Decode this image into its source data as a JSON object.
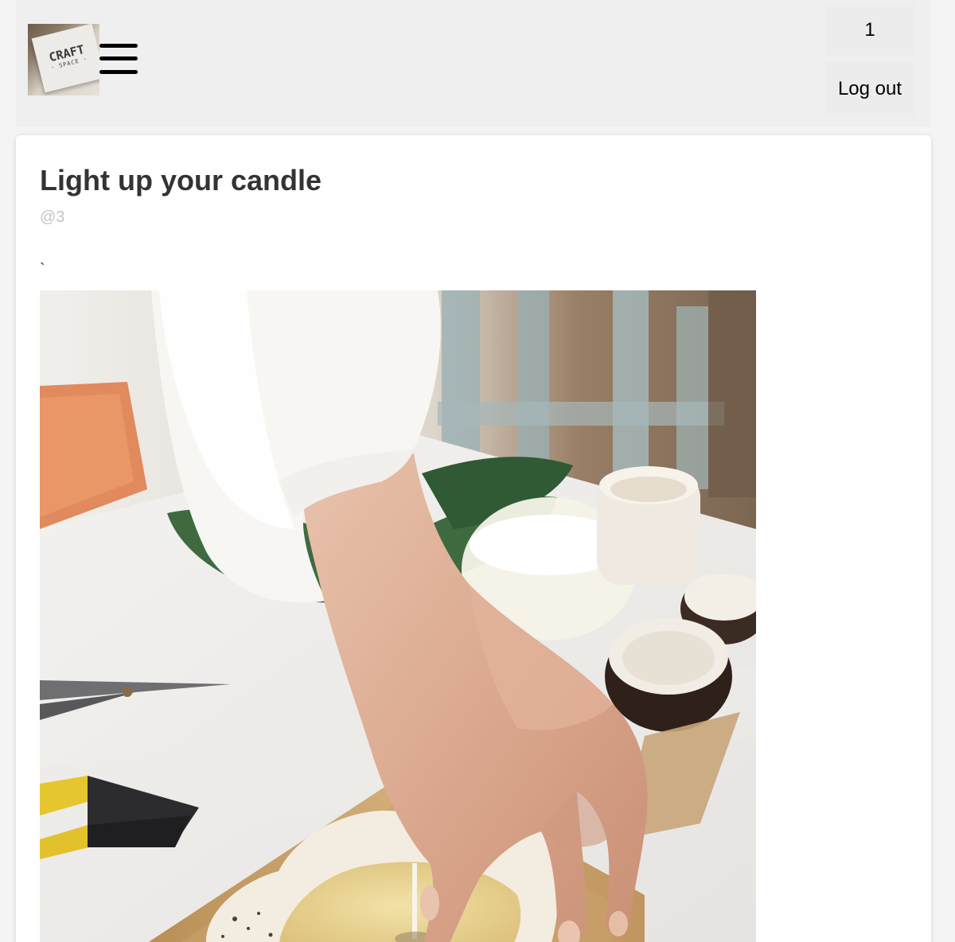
{
  "header": {
    "logo": {
      "name": "craft-space-logo",
      "text_line1": "CRAFT",
      "text_line2": "· SPACE ·"
    },
    "menu_icon": "hamburger-menu-icon",
    "user_badge": "1",
    "logout_label": "Log out"
  },
  "post": {
    "title": "Light up your candle",
    "author": "@3",
    "body": "`",
    "image": {
      "subject": "hand placing a wick into a candle"
    }
  },
  "colors": {
    "page_background": "#f4f4f4",
    "header_background": "#efefef",
    "button_background": "#ececec",
    "card_background": "#ffffff",
    "title_text": "#333333",
    "author_text": "#c4c4c4"
  }
}
